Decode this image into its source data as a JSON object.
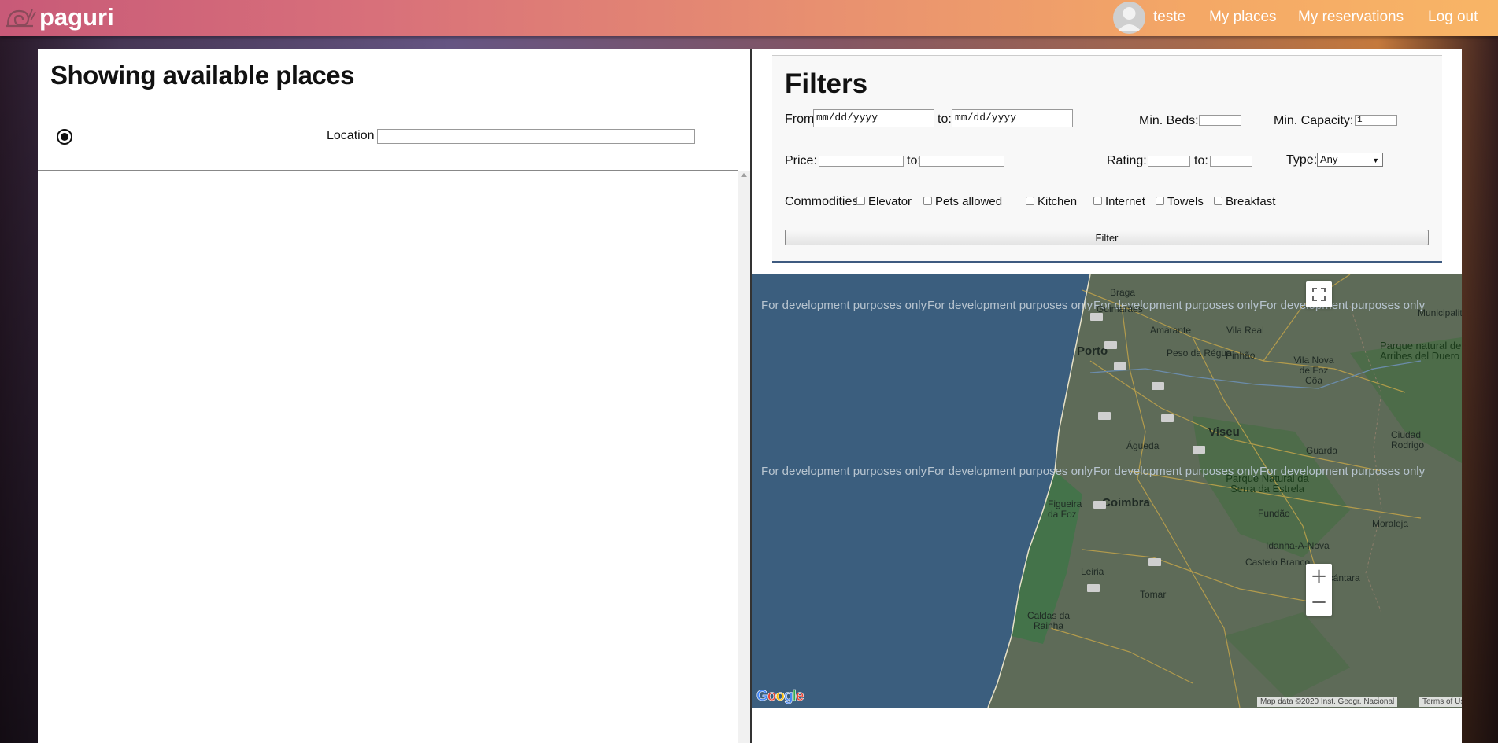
{
  "navbar": {
    "brand": "paguri",
    "username": "teste",
    "links": {
      "my_places": "My places",
      "my_reservations": "My reservations",
      "log_out": "Log out"
    }
  },
  "left": {
    "title": "Showing available places",
    "location_label": "Location",
    "location_value": ""
  },
  "filters": {
    "title": "Filters",
    "from_label": "From:",
    "from_placeholder": "mm/dd/yyyy",
    "to_label": "to:",
    "to_placeholder": "mm/dd/yyyy",
    "min_beds_label": "Min. Beds:",
    "min_beds_value": "",
    "min_capacity_label": "Min. Capacity:",
    "min_capacity_value": "1",
    "price_label": "Price:",
    "price_from": "",
    "price_to_label": "to:",
    "price_to": "",
    "rating_label": "Rating:",
    "rating_from": "",
    "rating_to_label": "to:",
    "rating_to": "",
    "type_label": "Type:",
    "type_selected": "Any",
    "commodities_label": "Commodities:",
    "commodities": [
      "Elevator",
      "Pets allowed",
      "Kitchen",
      "Internet",
      "Towels",
      "Breakfast"
    ],
    "filter_button": "Filter"
  },
  "map": {
    "dev_watermark": "For development purposes only",
    "places": [
      "Braga",
      "Guimarães",
      "Amarante",
      "Vila Real",
      "Porto",
      "Peso da Régua",
      "Pinhão",
      "Vila Nova de Foz Côa",
      "Municipality",
      "Parque natural de Arribes del Duero",
      "Viseu",
      "Águeda",
      "Guarda",
      "Ciudad Rodrigo",
      "Parque Natural da Serra da Estrela",
      "Figueira da Foz",
      "Coimbra",
      "Fundão",
      "Moraleja",
      "Idanha-A-Nova",
      "Castelo Branco",
      "Leiria",
      "Tomar",
      "Alcántara",
      "Caldas da Rainha"
    ],
    "google_logo": "Google",
    "attribution": "Map data ©2020 Inst. Geogr. Nacional",
    "terms": "Terms of Use",
    "zoom_in": "+",
    "zoom_out": "−"
  },
  "colors": {
    "navbar_start": "#c85a78",
    "navbar_end": "#f8b566",
    "filter_accent": "#3e5a80",
    "sea": "#3b5e7e"
  },
  "icons": {
    "logo": "snail-icon",
    "avatar": "user-avatar-icon",
    "fullscreen": "fullscreen-icon"
  }
}
